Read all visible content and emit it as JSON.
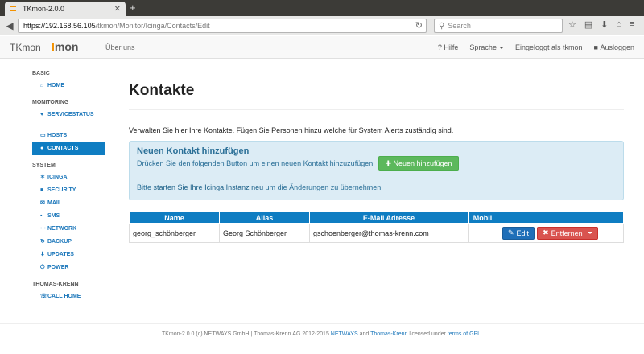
{
  "browser": {
    "tab_title": "TKmon-2.0.0",
    "tab_close": "✕",
    "new_tab": "+",
    "url_host": "https://192.168.56.105",
    "url_path": "/tkmon/Monitor/Icinga/Contacts/Edit",
    "search_placeholder": "Search"
  },
  "appnav": {
    "brand": "TKmon",
    "logo_prefix": "I",
    "logo_text": "mon",
    "about": "Über uns",
    "help": "Hilfe",
    "language": "Sprache",
    "logged_in": "Eingeloggt als tkmon",
    "logout": "Ausloggen"
  },
  "sidebar": {
    "sections": [
      {
        "heading": "BASIC",
        "items": [
          {
            "label": "HOME",
            "icon": "home-icon",
            "glyph": "⌂"
          }
        ]
      },
      {
        "heading": "MONITORING",
        "items": [
          {
            "label": "SERVICESTATUS",
            "icon": "heart-icon",
            "glyph": "♥"
          },
          {
            "label": "HOSTS",
            "icon": "monitor-icon",
            "glyph": "▭"
          },
          {
            "label": "CONTACTS",
            "icon": "user-icon",
            "glyph": "●"
          }
        ]
      },
      {
        "heading": "SYSTEM",
        "items": [
          {
            "label": "ICINGA",
            "icon": "icinga-icon",
            "glyph": "✶"
          },
          {
            "label": "SECURITY",
            "icon": "lock-icon",
            "glyph": "■"
          },
          {
            "label": "MAIL",
            "icon": "mail-icon",
            "glyph": "✉"
          },
          {
            "label": "SMS",
            "icon": "message-icon",
            "glyph": "▪"
          },
          {
            "label": "NETWORK",
            "icon": "network-icon",
            "glyph": "⋯"
          },
          {
            "label": "BACKUP",
            "icon": "refresh-icon",
            "glyph": "↻"
          },
          {
            "label": "UPDATES",
            "icon": "download-icon",
            "glyph": "⬇"
          },
          {
            "label": "POWER",
            "icon": "power-icon",
            "glyph": "⏻"
          }
        ]
      },
      {
        "heading": "THOMAS-KRENN",
        "items": [
          {
            "label": "CALL HOME",
            "icon": "phone-icon",
            "glyph": "☏"
          }
        ]
      }
    ]
  },
  "main": {
    "title": "Kontakte",
    "intro": "Verwalten Sie hier Ihre Kontakte. Fügen Sie Personen hinzu welche für System Alerts zuständig sind.",
    "alert": {
      "title": "Neuen Kontakt hinzufügen",
      "text": "Drücken Sie den folgenden Button um einen neuen Kontakt hinzuzufügen:",
      "button": "Neuen hinzufügen",
      "note_prefix": "Bitte",
      "note_link": "starten Sie Ihre Icinga Instanz neu",
      "note_suffix": "um die Änderungen zu übernehmen."
    },
    "table": {
      "headers": [
        "Name",
        "Alias",
        "E-Mail Adresse",
        "Mobil",
        ""
      ],
      "rows": [
        {
          "name": "georg_schönberger",
          "alias": "Georg Schönberger",
          "email": "gschoenberger@thomas-krenn.com",
          "mobile": "",
          "edit": "Edit",
          "remove": "Entfernen"
        }
      ]
    }
  },
  "footer": {
    "text1": "TKmon-2.0.0 (c) NETWAYS GmbH | Thomas-Krenn.AG 2012-2015",
    "link1": "NETWAYS",
    "and": "and",
    "link2": "Thomas-Krenn",
    "text2": "licensed under",
    "link3": "terms of GPL",
    "end": "."
  }
}
